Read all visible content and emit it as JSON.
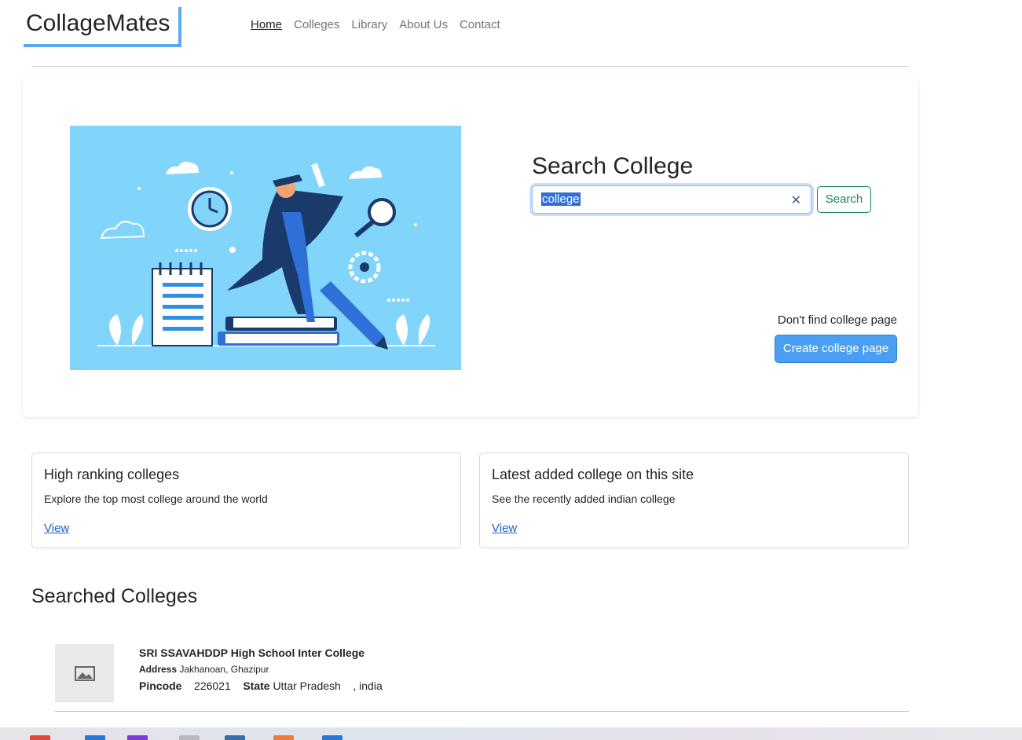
{
  "header": {
    "brand": "CollageMates",
    "nav": [
      {
        "label": "Home",
        "active": true
      },
      {
        "label": "Colleges",
        "active": false
      },
      {
        "label": "Library",
        "active": false
      },
      {
        "label": "About Us",
        "active": false
      },
      {
        "label": "Contact",
        "active": false
      }
    ]
  },
  "hero": {
    "illustration": "graduate-illustration",
    "search_title": "Search College",
    "search_value": "college",
    "clear_icon": "close-icon",
    "search_button": "Search",
    "dont_find_text": "Don't find college page",
    "create_button": "Create college page"
  },
  "cards": [
    {
      "title": "High ranking colleges",
      "text": "Explore the top most college around the world",
      "link": "View"
    },
    {
      "title": "Latest added college on this site",
      "text": "See the recently added indian college",
      "link": "View"
    }
  ],
  "results": {
    "title": "Searched Colleges",
    "items": [
      {
        "name": "SRI SSAVAHDDP High School Inter College",
        "address_label": "Address",
        "address": "Jakhanoan, Ghazipur",
        "pincode_label": "Pincode",
        "pincode": "226021",
        "state_label": "State",
        "state": "Uttar Pradesh",
        "country": ", india",
        "thumbnail_icon": "image-placeholder-icon"
      }
    ]
  },
  "colors": {
    "brand_accent": "#5aa8f0",
    "primary": "#4a9ff2",
    "success": "#198754",
    "illustration_bg": "#81d4fa"
  }
}
